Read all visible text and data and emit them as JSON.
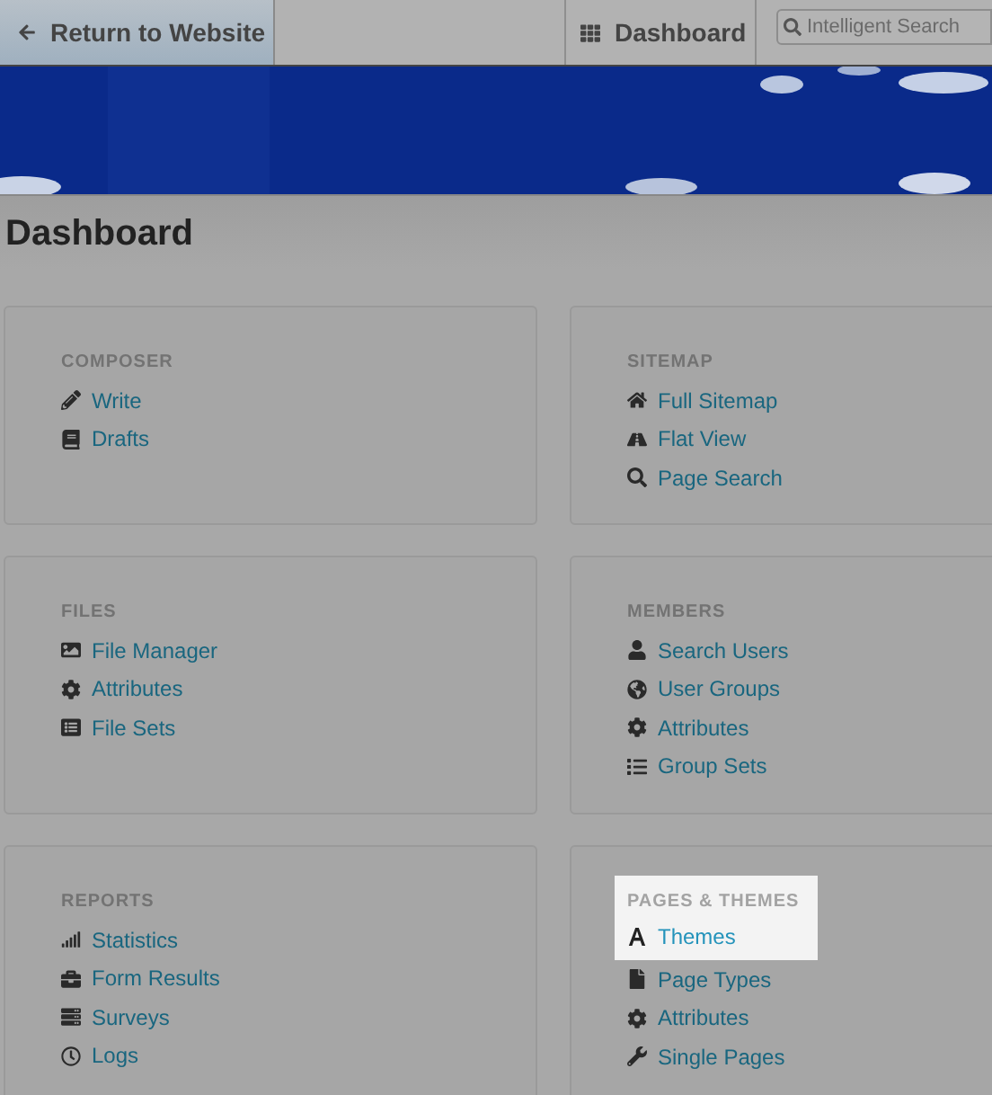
{
  "toolbar": {
    "return_button": "Return to Website",
    "dashboard_button": "Dashboard",
    "search": {
      "placeholder": "Intelligent Search"
    }
  },
  "page_title": "Dashboard",
  "sections": [
    {
      "title": "COMPOSER",
      "spotlight": false,
      "items": [
        {
          "label": "Write",
          "spotlight": false
        },
        {
          "label": "Drafts",
          "spotlight": false
        }
      ]
    },
    {
      "title": "SITEMAP",
      "spotlight": false,
      "items": [
        {
          "label": "Full Sitemap",
          "spotlight": false
        },
        {
          "label": "Flat View",
          "spotlight": false
        },
        {
          "label": "Page Search",
          "spotlight": false
        }
      ]
    },
    {
      "title": "FILES",
      "spotlight": false,
      "items": [
        {
          "label": "File Manager",
          "spotlight": false
        },
        {
          "label": "Attributes",
          "spotlight": false
        },
        {
          "label": "File Sets",
          "spotlight": false
        }
      ]
    },
    {
      "title": "MEMBERS",
      "spotlight": false,
      "items": [
        {
          "label": "Search Users",
          "spotlight": false
        },
        {
          "label": "User Groups",
          "spotlight": false
        },
        {
          "label": "Attributes",
          "spotlight": false
        },
        {
          "label": "Group Sets",
          "spotlight": false
        }
      ]
    },
    {
      "title": "REPORTS",
      "spotlight": false,
      "items": [
        {
          "label": "Statistics",
          "spotlight": false
        },
        {
          "label": "Form Results",
          "spotlight": false
        },
        {
          "label": "Surveys",
          "spotlight": false
        },
        {
          "label": "Logs",
          "spotlight": false
        }
      ]
    },
    {
      "title": "PAGES & THEMES",
      "spotlight": true,
      "items": [
        {
          "label": "Themes",
          "spotlight": true
        },
        {
          "label": "Page Types",
          "spotlight": false
        },
        {
          "label": "Attributes",
          "spotlight": false
        },
        {
          "label": "Single Pages",
          "spotlight": false
        }
      ]
    }
  ]
}
